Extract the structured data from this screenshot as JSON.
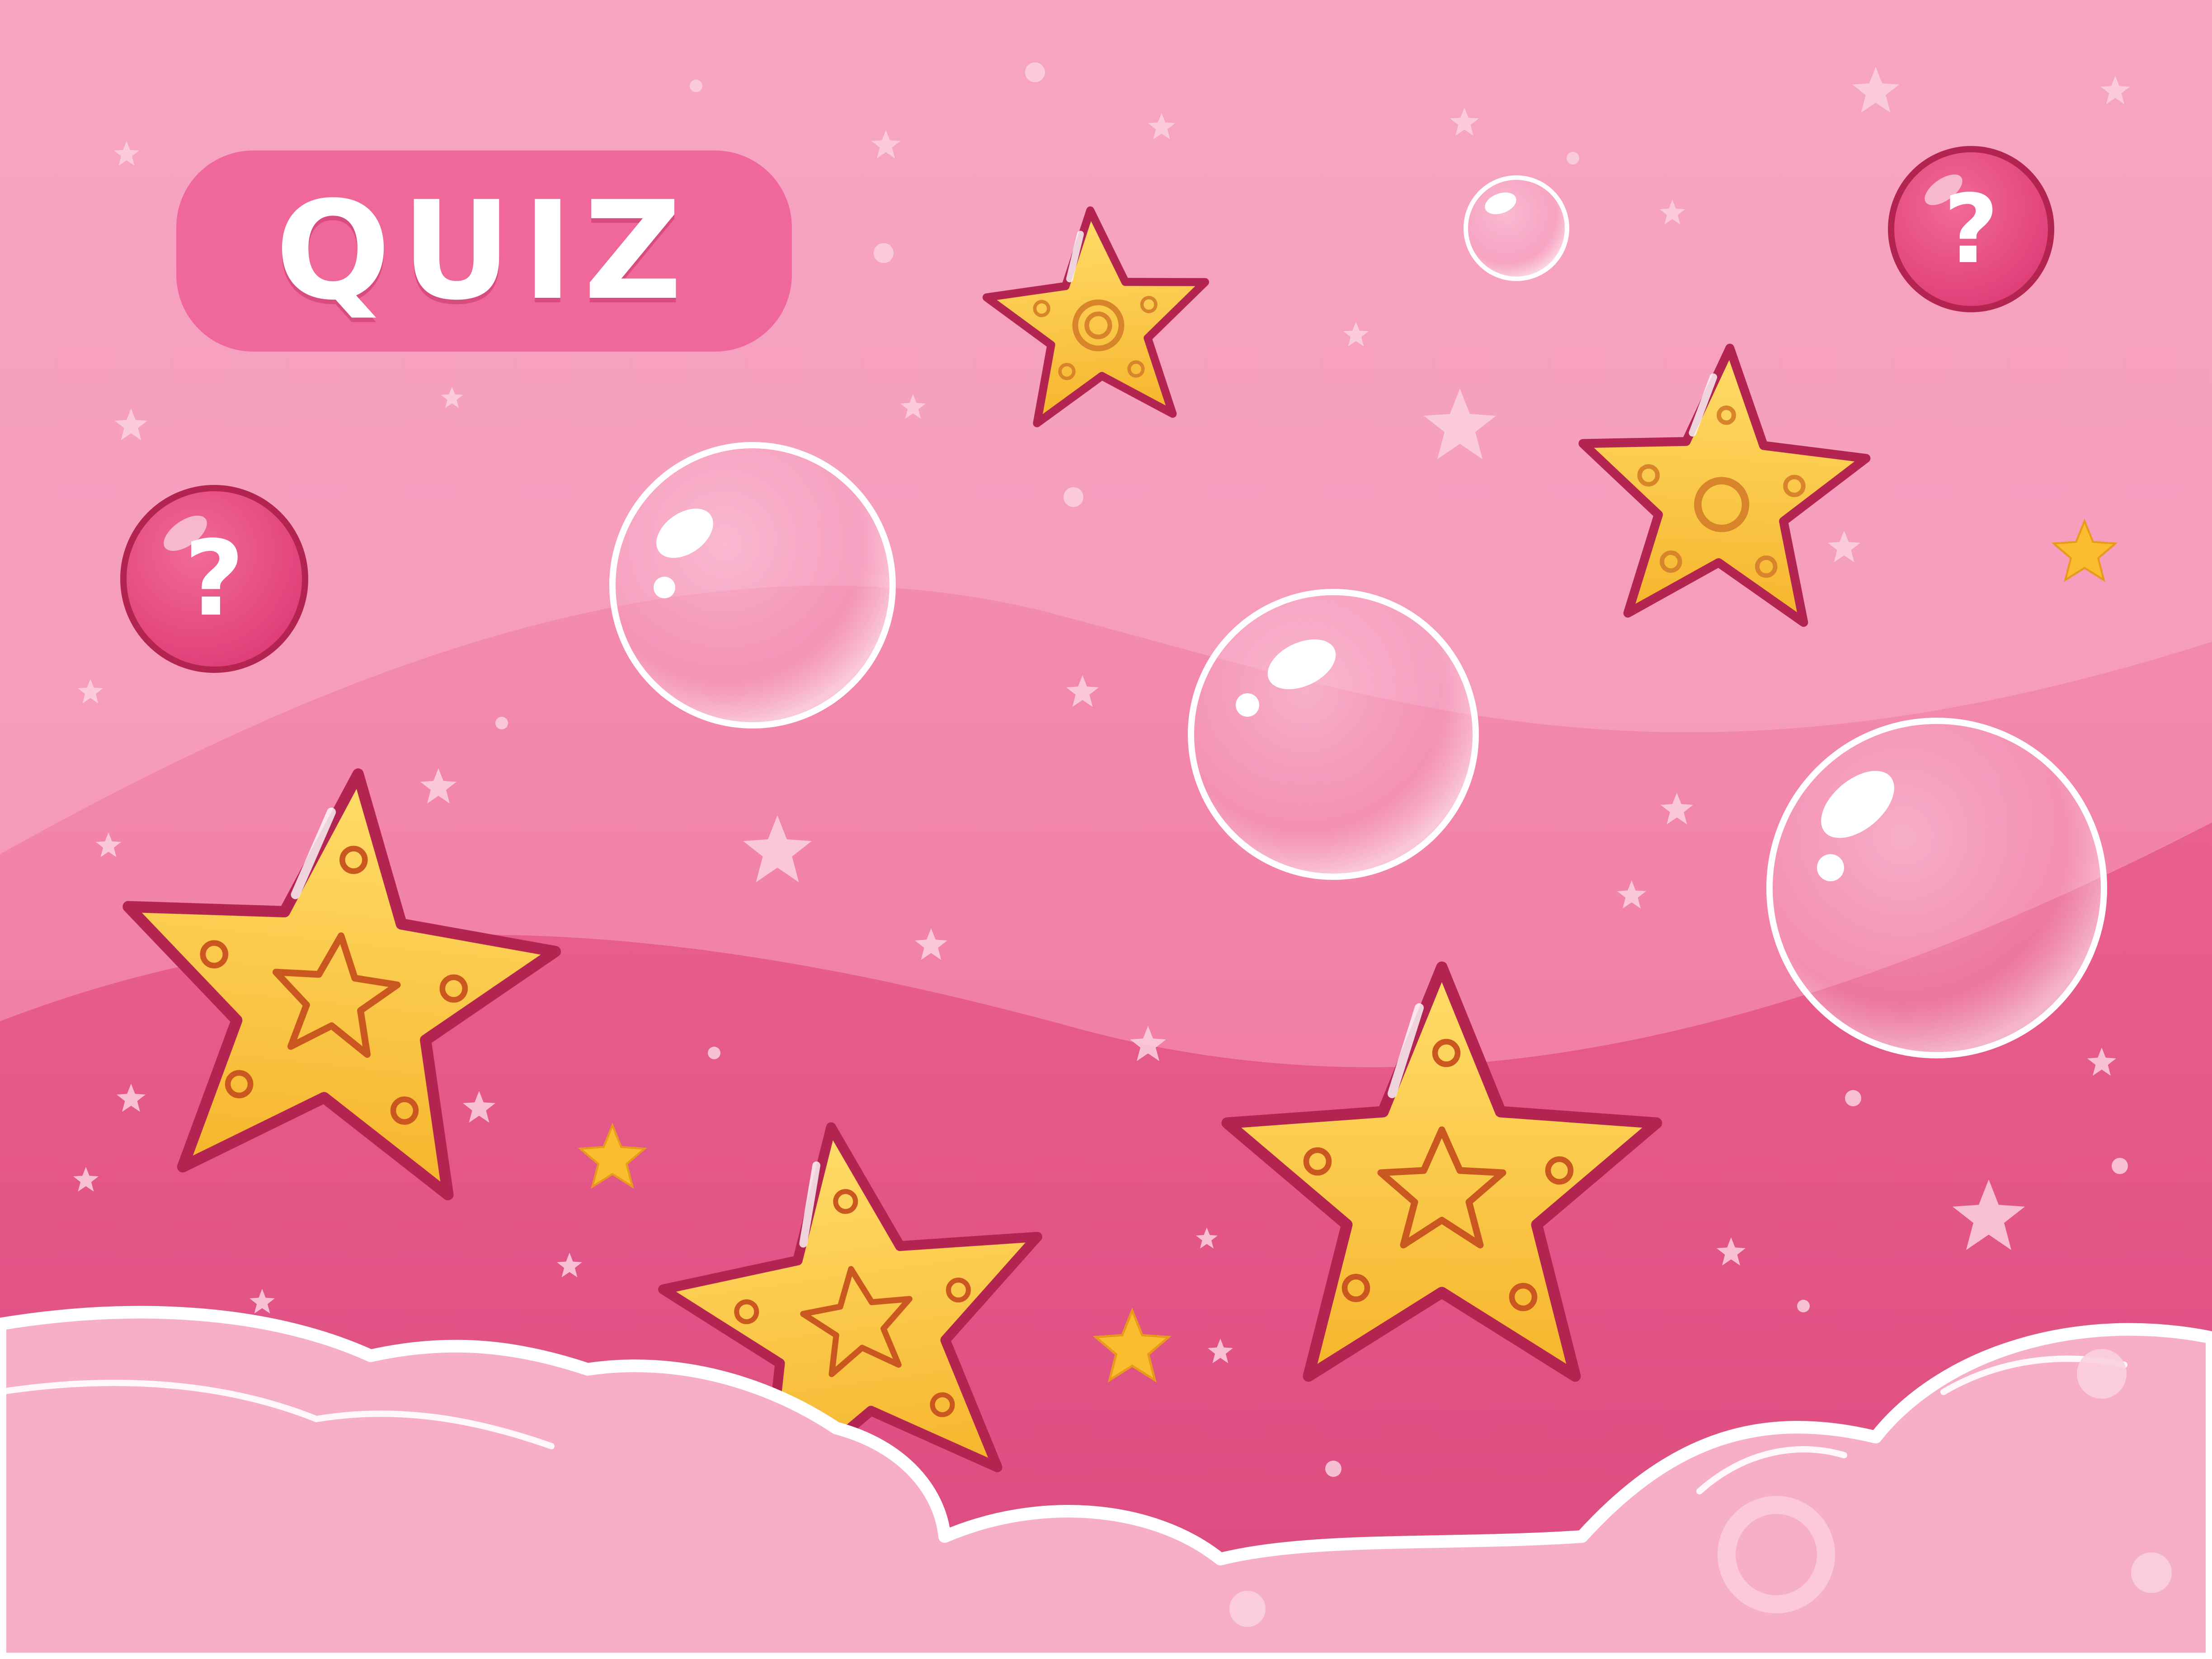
{
  "screen": {
    "title": "QUIZ",
    "question_marks": [
      "?",
      "?"
    ]
  },
  "colors": {
    "sky": "#f79bbb",
    "sky_light": "#f8a9c6",
    "wave_mid": "#f07aa2",
    "wave_deep": "#e25586",
    "badge": "#f06a97",
    "star_fill": "#fbc840",
    "star_light": "#ffe27a",
    "star_outline": "#b32550",
    "cloud": "#f8b3cc",
    "cloud_outline": "#ffffff",
    "question_bubble": "#ea4b82"
  },
  "icons": {
    "big_stars": "star-icon",
    "bubbles": "bubble-icon",
    "sparkles": "sparkle-icon",
    "question": "question-mark-icon"
  }
}
